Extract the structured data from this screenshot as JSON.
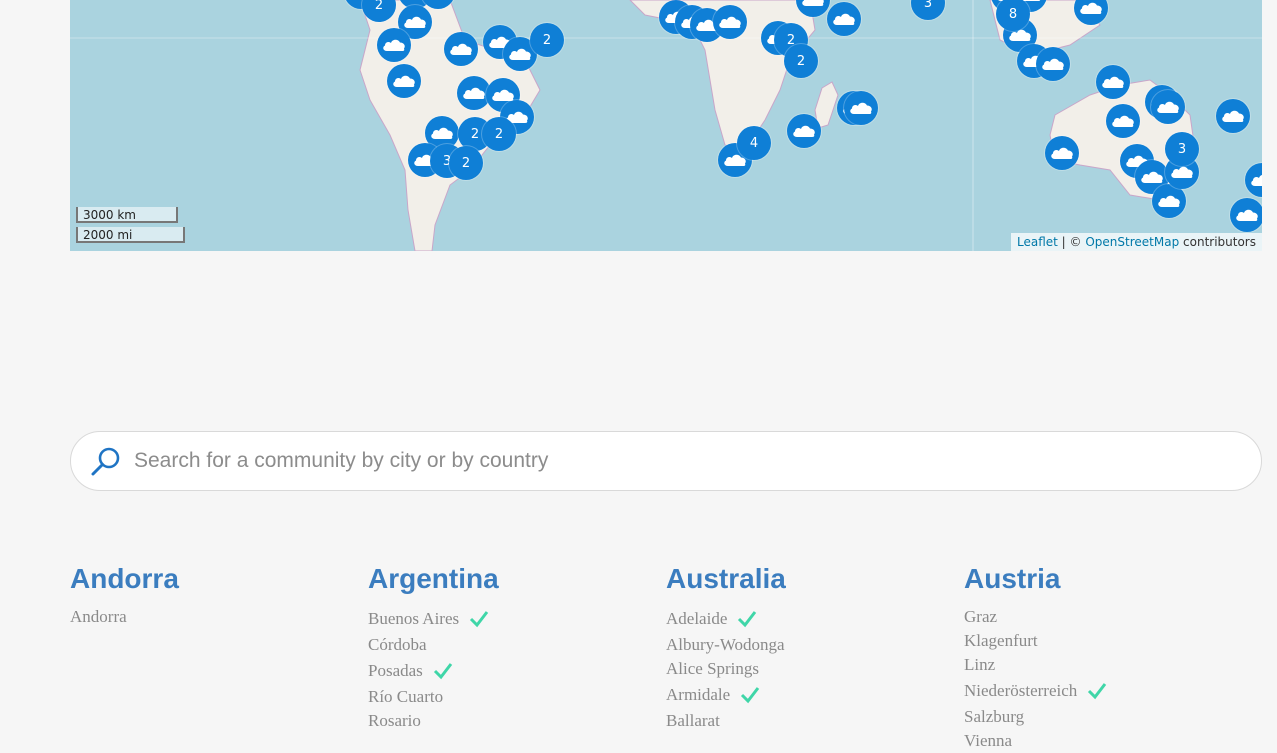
{
  "map": {
    "scale_km": "3000 km",
    "scale_mi": "2000 mi",
    "attribution": {
      "leaflet": "Leaflet",
      "separator": " | © ",
      "osm": "OpenStreetMap",
      "suffix": " contributors"
    },
    "marker_color": "#0f7fd6",
    "cluster_labels": [
      "2",
      "2",
      "3",
      "2",
      "2",
      "2",
      "2",
      "2",
      "4",
      "3",
      "8",
      "3"
    ]
  },
  "search": {
    "placeholder": "Search for a community by city or by country"
  },
  "countries": [
    {
      "name": "Andorra",
      "cities": [
        {
          "name": "Andorra",
          "active": false
        }
      ]
    },
    {
      "name": "Argentina",
      "cities": [
        {
          "name": "Buenos Aires",
          "active": true
        },
        {
          "name": "Córdoba",
          "active": false
        },
        {
          "name": "Posadas",
          "active": true
        },
        {
          "name": "Río Cuarto",
          "active": false
        },
        {
          "name": "Rosario",
          "active": false
        }
      ]
    },
    {
      "name": "Australia",
      "cities": [
        {
          "name": "Adelaide",
          "active": true
        },
        {
          "name": "Albury-Wodonga",
          "active": false
        },
        {
          "name": "Alice Springs",
          "active": false
        },
        {
          "name": "Armidale",
          "active": true
        },
        {
          "name": "Ballarat",
          "active": false
        }
      ]
    },
    {
      "name": "Austria",
      "cities": [
        {
          "name": "Graz",
          "active": false
        },
        {
          "name": "Klagenfurt",
          "active": false
        },
        {
          "name": "Linz",
          "active": false
        },
        {
          "name": "Niederösterreich",
          "active": true
        },
        {
          "name": "Salzburg",
          "active": false
        },
        {
          "name": "Vienna",
          "active": false
        }
      ]
    }
  ],
  "colors": {
    "heading": "#3b7dbf",
    "city": "#8a8a8a",
    "check": "#3fd6a8",
    "water": "#aad3df",
    "land": "#f2efe9"
  }
}
